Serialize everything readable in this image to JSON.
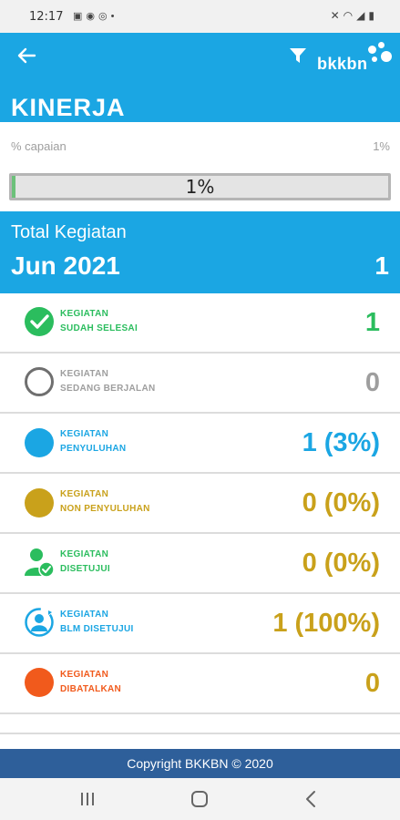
{
  "status_bar": {
    "time": "12:17",
    "left_icons": [
      "image-icon",
      "messenger-icon",
      "whatsapp-icon",
      "dot-icon"
    ],
    "right_icons": [
      "mute-icon",
      "wifi-icon",
      "signal-icon",
      "battery-icon"
    ]
  },
  "header": {
    "logo_text": "bkkbn",
    "title": "KINERJA",
    "icons": {
      "back": "arrow-left-icon",
      "filter": "filter-icon"
    }
  },
  "progress": {
    "label": "% capaian",
    "value_text": "1%",
    "bar_text": "1%",
    "fraction": 0.01
  },
  "total": {
    "label": "Total Kegiatan",
    "period": "Jun 2021",
    "count": "1"
  },
  "rows": [
    {
      "line1": "KEGIATAN",
      "line2": "SUDAH SELESAI",
      "value": "1",
      "color": "#2bbd5e",
      "icon": "check-circle-icon"
    },
    {
      "line1": "KEGIATAN",
      "line2": "SEDANG BERJALAN",
      "value": "0",
      "color": "#9e9e9e",
      "icon": "empty-circle-icon"
    },
    {
      "line1": "KEGIATAN",
      "line2": "PENYULUHAN",
      "value": "1 (3%)",
      "color": "#1ba6e3",
      "icon": "blue-circle-icon"
    },
    {
      "line1": "KEGIATAN",
      "line2": "NON PENYULUHAN",
      "value": "0 (0%)",
      "color": "#c9a11b",
      "icon": "gold-circle-icon"
    },
    {
      "line1": "KEGIATAN",
      "line2": "DISETUJUI",
      "value": "0 (0%)",
      "color": "#2bbd5e",
      "value_color": "#c9a11b",
      "icon": "user-approved-icon"
    },
    {
      "line1": "KEGIATAN",
      "line2": "BLM DISETUJUI",
      "value": "1 (100%)",
      "color": "#1ba6e3",
      "value_color": "#c9a11b",
      "icon": "user-pending-icon"
    },
    {
      "line1": "KEGIATAN",
      "line2": "DIBATALKAN",
      "value": "0",
      "color": "#f15a1c",
      "value_color": "#c9a11b",
      "icon": "orange-circle-icon"
    }
  ],
  "footer": {
    "text": "Copyright BKKBN © 2020"
  },
  "nav": {
    "icons": [
      "recent-apps-icon",
      "home-icon",
      "back-nav-icon"
    ]
  },
  "colors": {
    "primary": "#1ba6e3",
    "footer": "#2e5f9a",
    "success": "#2bbd5e",
    "gold": "#c9a11b",
    "danger": "#f15a1c"
  }
}
